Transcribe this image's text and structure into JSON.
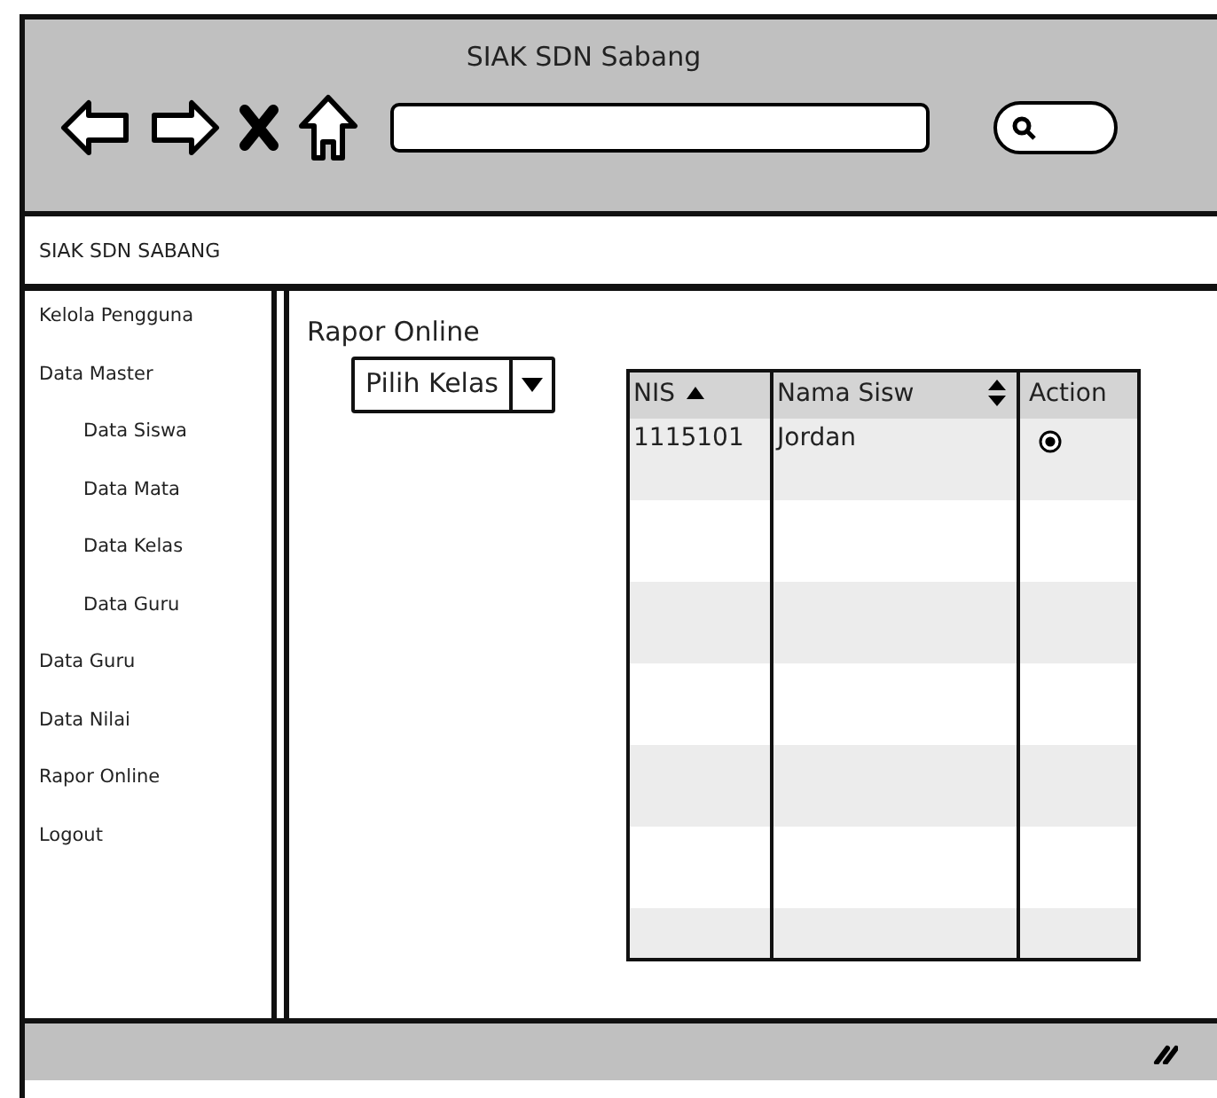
{
  "window": {
    "title": "SIAK SDN Sabang"
  },
  "header": {
    "title": "SIAK SDN SABANG"
  },
  "sidebar": {
    "items": [
      {
        "label": "Kelola Pengguna"
      },
      {
        "label": "Data Master",
        "children": [
          {
            "label": "Data Siswa"
          },
          {
            "label": "Data Mata"
          },
          {
            "label": "Data Kelas"
          },
          {
            "label": "Data Guru"
          }
        ]
      },
      {
        "label": "Data Guru"
      },
      {
        "label": "Data Nilai"
      },
      {
        "label": "Rapor Online"
      },
      {
        "label": "Logout"
      }
    ]
  },
  "page": {
    "title": "Rapor Online",
    "dropdown": {
      "value": "Pilih Kelas"
    }
  },
  "table": {
    "columns": [
      {
        "label": "NIS",
        "kind": "ascending"
      },
      {
        "label": "Nama Sisw",
        "kind": "sortable"
      },
      {
        "label": "Action",
        "kind": "plain"
      }
    ],
    "rows": [
      {
        "nis": "1115101",
        "nama": "Jordan",
        "selected": true
      }
    ]
  }
}
